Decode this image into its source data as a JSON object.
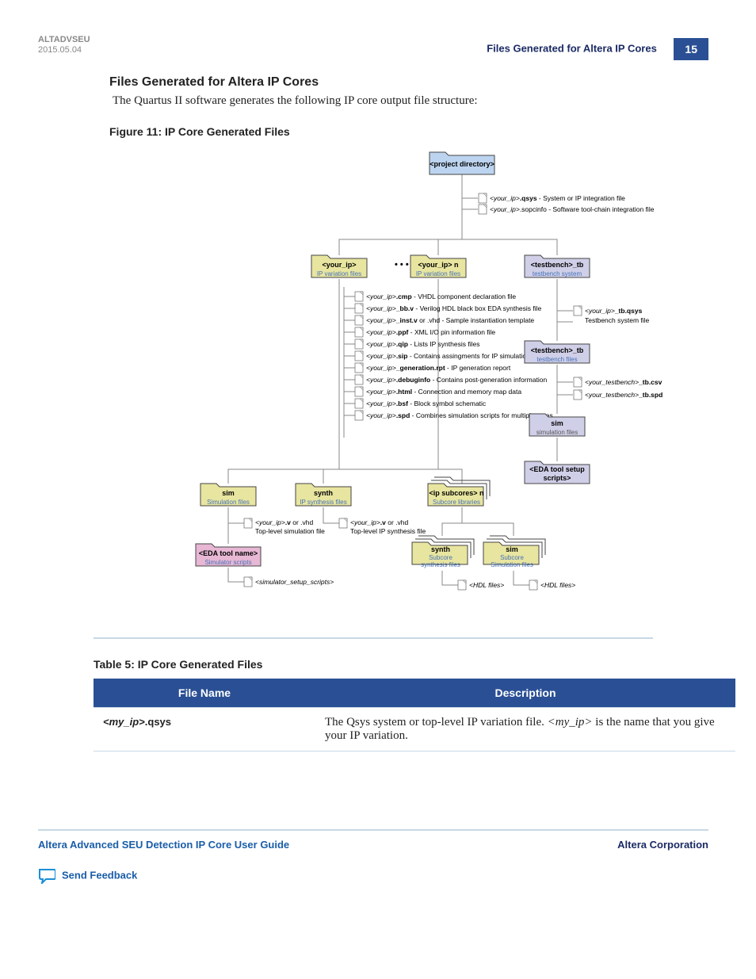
{
  "header": {
    "doc_code": "ALTADVSEU",
    "date": "2015.05.04",
    "running_title": "Files Generated for Altera IP Cores",
    "page_num": "15"
  },
  "section": {
    "title": "Files Generated for Altera IP Cores",
    "body": "The Quartus II software generates the following IP core output file structure:"
  },
  "figure": {
    "caption": "Figure 11: IP Core Generated Files",
    "nodes": {
      "proj_dir": "<project directory>",
      "your_ip": "<your_ip>",
      "your_ip_sub": "IP variation files",
      "your_ip_n": "<your_ip> n",
      "your_ip_n_sub": "IP variation files",
      "testbench_tb": "<testbench>_tb",
      "testbench_tb_sub": "testbench system",
      "testbench_tb2": "<testbench>_tb",
      "testbench_tb2_sub": "testbench files",
      "sim_tb": "sim",
      "sim_tb_sub": "simulation files",
      "eda_setup": "<EDA tool setup",
      "eda_setup2": "scripts>",
      "sim": "sim",
      "sim_sub": "Simulation files",
      "synth": "synth",
      "synth_sub": "IP synthesis files",
      "ipsub": "<ip subcores> n",
      "ipsub_sub": "Subcore libraries",
      "eda_tool": "<EDA tool name>",
      "eda_tool_sub": "Simulator scripts",
      "sub_synth": "synth",
      "sub_synth_sub1": "Subcore",
      "sub_synth_sub2": "synthesis files",
      "sub_sim": "sim",
      "sub_sim_sub1": "Subcore",
      "sub_sim_sub2": "Simulation files"
    },
    "files_root": [
      {
        "pre": "<your_ip>",
        "b": ".qsys",
        "post": " - System or IP integration file"
      },
      {
        "pre": "<your_ip>",
        "b": "",
        "post": ".sopcinfo - Software tool-chain integration file"
      }
    ],
    "files_ip": [
      {
        "pre": "<your_ip>",
        "b": ".cmp",
        "post": " - VHDL component declaration file"
      },
      {
        "pre": "<your_ip>",
        "b": "_bb.v",
        "post": " - Verilog HDL black box EDA synthesis file"
      },
      {
        "pre": "<your_ip>",
        "b": "_inst.v",
        "post": " or .vhd - Sample instantiation template"
      },
      {
        "pre": "<your_ip>",
        "b": ".ppf",
        "post": " - XML I/O pin information file"
      },
      {
        "pre": "<your_ip>",
        "b": ".qip",
        "post": " - Lists IP synthesis files"
      },
      {
        "pre": "<your_ip>",
        "b": ".sip",
        "post": " - Contains assingments for IP simulation files"
      },
      {
        "pre": "<your_ip>",
        "b": "_generation.rpt",
        "post": " - IP generation report"
      },
      {
        "pre": "<your_ip>",
        "b": ".debuginfo",
        "post": " - Contains post-generation information"
      },
      {
        "pre": "<your_ip>",
        "b": ".html",
        "post": " - Connection and memory map data"
      },
      {
        "pre": "<your_ip>",
        "b": ".bsf",
        "post": " - Block symbol schematic"
      },
      {
        "pre": "<your_ip>",
        "b": ".spd",
        "post": " - Combines simulation scripts for multiple cores"
      }
    ],
    "files_tb": [
      {
        "pre": "<your_ip>",
        "b": "_tb.qsys",
        "post": ""
      },
      {
        "pre": "",
        "b": "",
        "post": "Testbench system file"
      }
    ],
    "files_tb2": [
      {
        "pre": "<your_testbench>",
        "b": "_tb.csv",
        "post": ""
      },
      {
        "pre": "<your_testbench>",
        "b": "_tb.spd",
        "post": ""
      }
    ],
    "files_sim": [
      {
        "pre": "<your_ip>",
        "b": ".v",
        "post": " or .vhd"
      },
      {
        "pre": "",
        "b": "",
        "post": "Top-level simulation file"
      }
    ],
    "files_synth": [
      {
        "pre": "<your_ip>",
        "b": ".v",
        "post": " or .vhd"
      },
      {
        "pre": "",
        "b": "",
        "post": "Top-level IP synthesis file"
      }
    ],
    "files_edatool": [
      {
        "pre": "<simulator_setup_scripts>",
        "b": "",
        "post": ""
      }
    ],
    "files_subsynth": [
      {
        "pre": "<HDL files>",
        "b": "",
        "post": ""
      }
    ],
    "files_subsim": [
      {
        "pre": "<HDL files>",
        "b": "",
        "post": ""
      }
    ],
    "dots": "• • • •"
  },
  "table": {
    "caption": "Table 5: IP Core Generated Files",
    "headers": [
      "File Name",
      "Description"
    ],
    "rows": [
      {
        "file_pre": "<my_ip>",
        "file_b": ".qsys",
        "desc_1": "The Qsys system or top-level IP variation file. ",
        "desc_em": "<my_ip>",
        "desc_2": " is the name that you give your IP variation."
      }
    ]
  },
  "footer": {
    "left": "Altera Advanced SEU Detection IP Core User Guide",
    "right": "Altera Corporation",
    "feedback": "Send Feedback"
  }
}
